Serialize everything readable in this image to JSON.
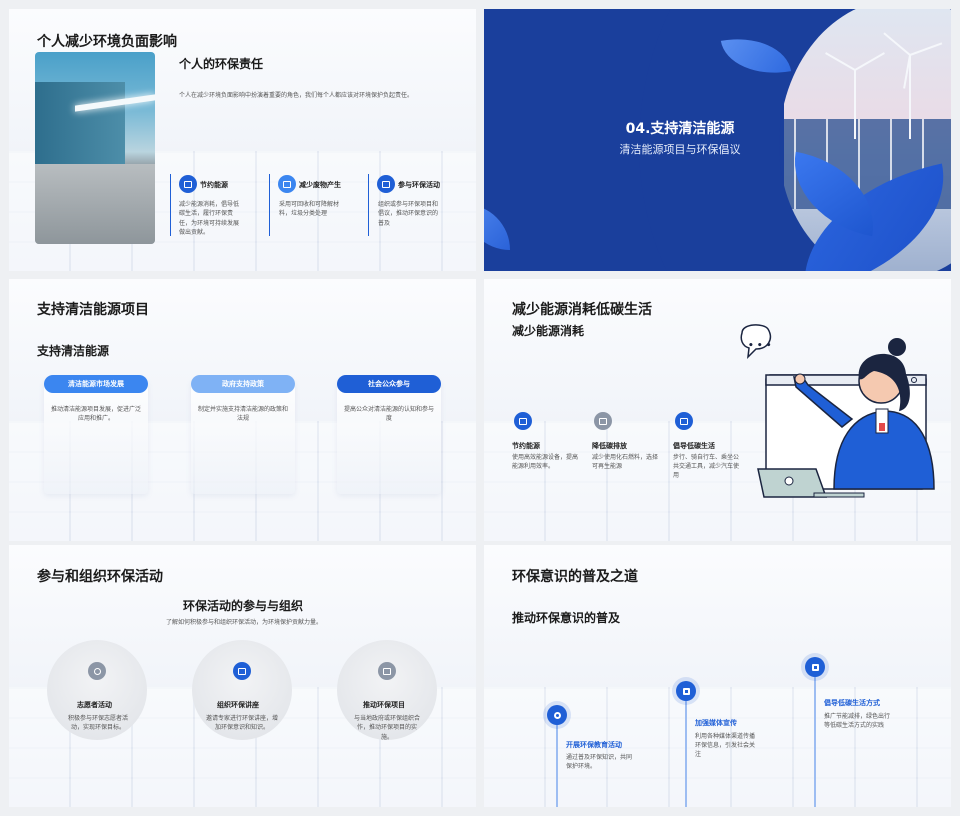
{
  "slide1": {
    "title": "个人减少环境负面影响",
    "subtitle": "个人的环保责任",
    "intro": "个人在减少环境负面影响中扮演着重要的角色，我们每个人都应该对环境保护负起责任。",
    "items": [
      {
        "label": "节约能源",
        "desc": "减少能源消耗，倡导低碳生活，履行环保责任，为环境可持续发展做出贡献。",
        "icon": "car-icon"
      },
      {
        "label": "减少废物产生",
        "desc": "采用可回收和可降解材料，垃圾分类处理",
        "icon": "recycle-icon"
      },
      {
        "label": "参与环保活动",
        "desc": "组织或参与环保项目和倡议，推动环保意识的普及",
        "icon": "toolbox-icon"
      }
    ]
  },
  "slide2": {
    "number_title": "04.支持清洁能源",
    "subtitle": "清洁能源项目与环保倡议"
  },
  "slide3": {
    "title": "支持清洁能源项目",
    "subtitle": "支持清洁能源",
    "cards": [
      {
        "label": "清洁能源市场发展",
        "desc": "推动清洁能源项目发展，促进广泛应用和推广。",
        "color": "#3b86f0"
      },
      {
        "label": "政府支持政策",
        "desc": "制定并实施支持清洁能源的政策和法规",
        "color": "#7fb2f5"
      },
      {
        "label": "社会公众参与",
        "desc": "提高公众对清洁能源的认知和参与度",
        "color": "#1f5fd6"
      }
    ]
  },
  "slide4": {
    "title": "减少能源消耗低碳生活",
    "subtitle": "减少能源消耗",
    "bubble": "• • •",
    "items": [
      {
        "label": "节约能源",
        "desc": "使用高效能源设备，提高能源利用效率。",
        "icon": "plug-icon"
      },
      {
        "label": "降低碳排放",
        "desc": "减少使用化石燃料，选择可再生能源",
        "icon": "document-icon"
      },
      {
        "label": "倡导低碳生活",
        "desc": "步行、骑自行车、乘坐公共交通工具，减少汽车使用",
        "icon": "plug-icon"
      }
    ]
  },
  "slide5": {
    "title": "参与和组织环保活动",
    "subtitle": "环保活动的参与与组织",
    "intro": "了解如何积极参与和组织环保活动，为环境保护贡献力量。",
    "items": [
      {
        "label": "志愿者活动",
        "desc": "积极参与环保志愿者活动，实现环保目标。",
        "icon": "location-icon",
        "color": "#8c96a6"
      },
      {
        "label": "组织环保讲座",
        "desc": "邀请专家进行环保讲座，增加环保意识和知识。",
        "icon": "image-icon",
        "color": "#1f5fd6"
      },
      {
        "label": "推动环保项目",
        "desc": "与当地政府或环保组织合作，推动环保项目的实施。",
        "icon": "toolbox-icon",
        "color": "#8c96a6"
      }
    ]
  },
  "slide6": {
    "title": "环保意识的普及之道",
    "subtitle": "推动环保意识的普及",
    "items": [
      {
        "label": "开展环保教育活动",
        "desc": "通过普及环保知识，共同保护环境。",
        "icon": "location-icon"
      },
      {
        "label": "加强媒体宣传",
        "desc": "利用各种媒体渠道传播环保信息，引发社会关注",
        "icon": "network-icon"
      },
      {
        "label": "倡导低碳生活方式",
        "desc": "推广节能减排，绿色出行等低碳生活方式的实践",
        "icon": "image-icon"
      }
    ]
  }
}
